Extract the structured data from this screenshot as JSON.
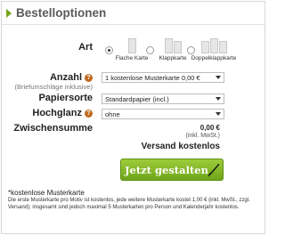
{
  "header": {
    "title": "Bestelloptionen"
  },
  "art": {
    "label": "Art",
    "options": [
      {
        "label": "Flache Karte",
        "selected": true
      },
      {
        "label": "Klappkarte",
        "selected": false
      },
      {
        "label": "Doppelklappkarte",
        "selected": false
      }
    ]
  },
  "anzahl": {
    "label": "Anzahl",
    "sublabel": "(Briefumschläge inklusive)",
    "value": "1 kostenlose Musterkarte 0,00 €"
  },
  "papiersorte": {
    "label": "Papiersorte",
    "value": "Standardpapier (incl.)"
  },
  "hochglanz": {
    "label": "Hochglanz",
    "value": "ohne"
  },
  "zwischensumme": {
    "label": "Zwischensumme",
    "value": "0,00 €",
    "note": "(inkl. MwSt.)"
  },
  "versand": "Versand kostenlos",
  "cta": {
    "label": "Jetzt gestalten"
  },
  "footnote": {
    "title": "*kostenlose Musterkarte",
    "text": "Die erste Musterkarte pro Motiv ist kostenlos, jede weitere Musterkarte kostet 1,00 € (inkl. MwSt., zzgl. Versand); insgesamt sind jedoch maximal 5 Musterkarten pro Person und Kalenderjahr kostenlos."
  },
  "colors": {
    "accent_green": "#76a619",
    "help_orange": "#c06a1e"
  }
}
